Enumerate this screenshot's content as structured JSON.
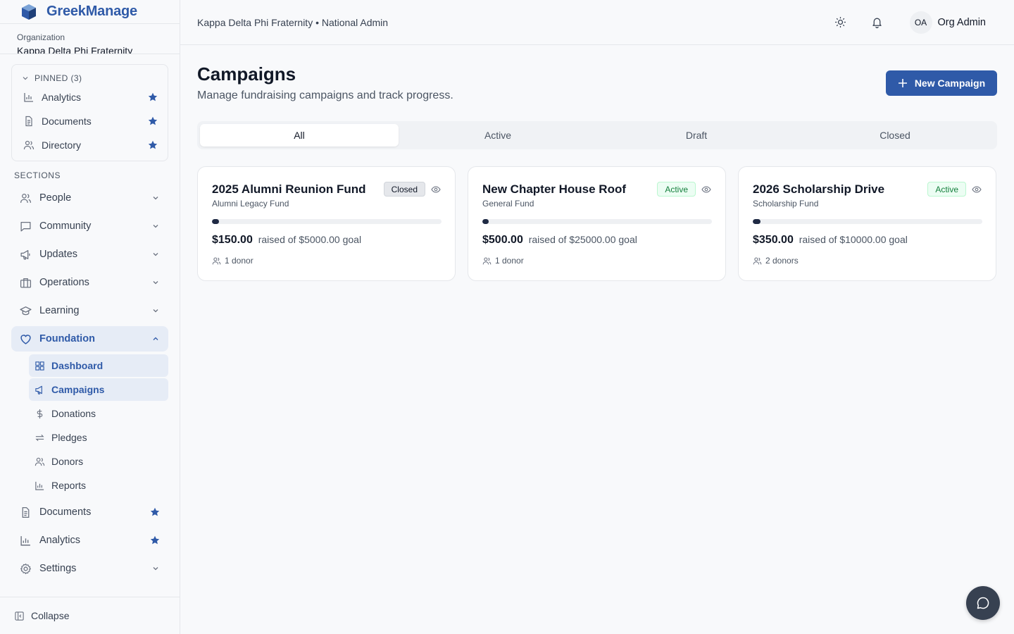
{
  "brand": {
    "name": "GreekManage"
  },
  "org": {
    "label": "Organization",
    "name": "Kappa Delta Phi Fraternity"
  },
  "pinned": {
    "header": "PINNED (3)",
    "items": [
      {
        "label": "Analytics",
        "icon": "bar-chart-icon"
      },
      {
        "label": "Documents",
        "icon": "document-icon"
      },
      {
        "label": "Directory",
        "icon": "users-icon"
      }
    ]
  },
  "sections_label": "SECTIONS",
  "nav": {
    "people": "People",
    "community": "Community",
    "updates": "Updates",
    "operations": "Operations",
    "learning": "Learning",
    "foundation": "Foundation",
    "foundation_sub": {
      "dashboard": "Dashboard",
      "campaigns": "Campaigns",
      "donations": "Donations",
      "pledges": "Pledges",
      "donors": "Donors",
      "reports": "Reports"
    },
    "documents": "Documents",
    "analytics": "Analytics",
    "settings": "Settings"
  },
  "collapse_label": "Collapse",
  "topbar": {
    "breadcrumb": "Kappa Delta Phi Fraternity • National Admin",
    "avatar_initials": "OA",
    "user_name": "Org Admin"
  },
  "page": {
    "title": "Campaigns",
    "subtitle": "Manage fundraising campaigns and track progress.",
    "new_button": "New Campaign"
  },
  "tabs": [
    "All",
    "Active",
    "Draft",
    "Closed"
  ],
  "campaigns": [
    {
      "title": "2025 Alumni Reunion Fund",
      "fund": "Alumni Legacy Fund",
      "status": "Closed",
      "raised": "$150.00",
      "goal_text": "raised of $5000.00 goal",
      "donors": "1 donor",
      "progress": 0.03
    },
    {
      "title": "New Chapter House Roof",
      "fund": "General Fund",
      "status": "Active",
      "raised": "$500.00",
      "goal_text": "raised of $25000.00 goal",
      "donors": "1 donor",
      "progress": 0.02
    },
    {
      "title": "2026 Scholarship Drive",
      "fund": "Scholarship Fund",
      "status": "Active",
      "raised": "$350.00",
      "goal_text": "raised of $10000.00 goal",
      "donors": "2 donors",
      "progress": 0.035
    }
  ],
  "colors": {
    "accent": "#2f5aa8",
    "progress": "#1f2a44",
    "active_badge": "#15803d"
  }
}
